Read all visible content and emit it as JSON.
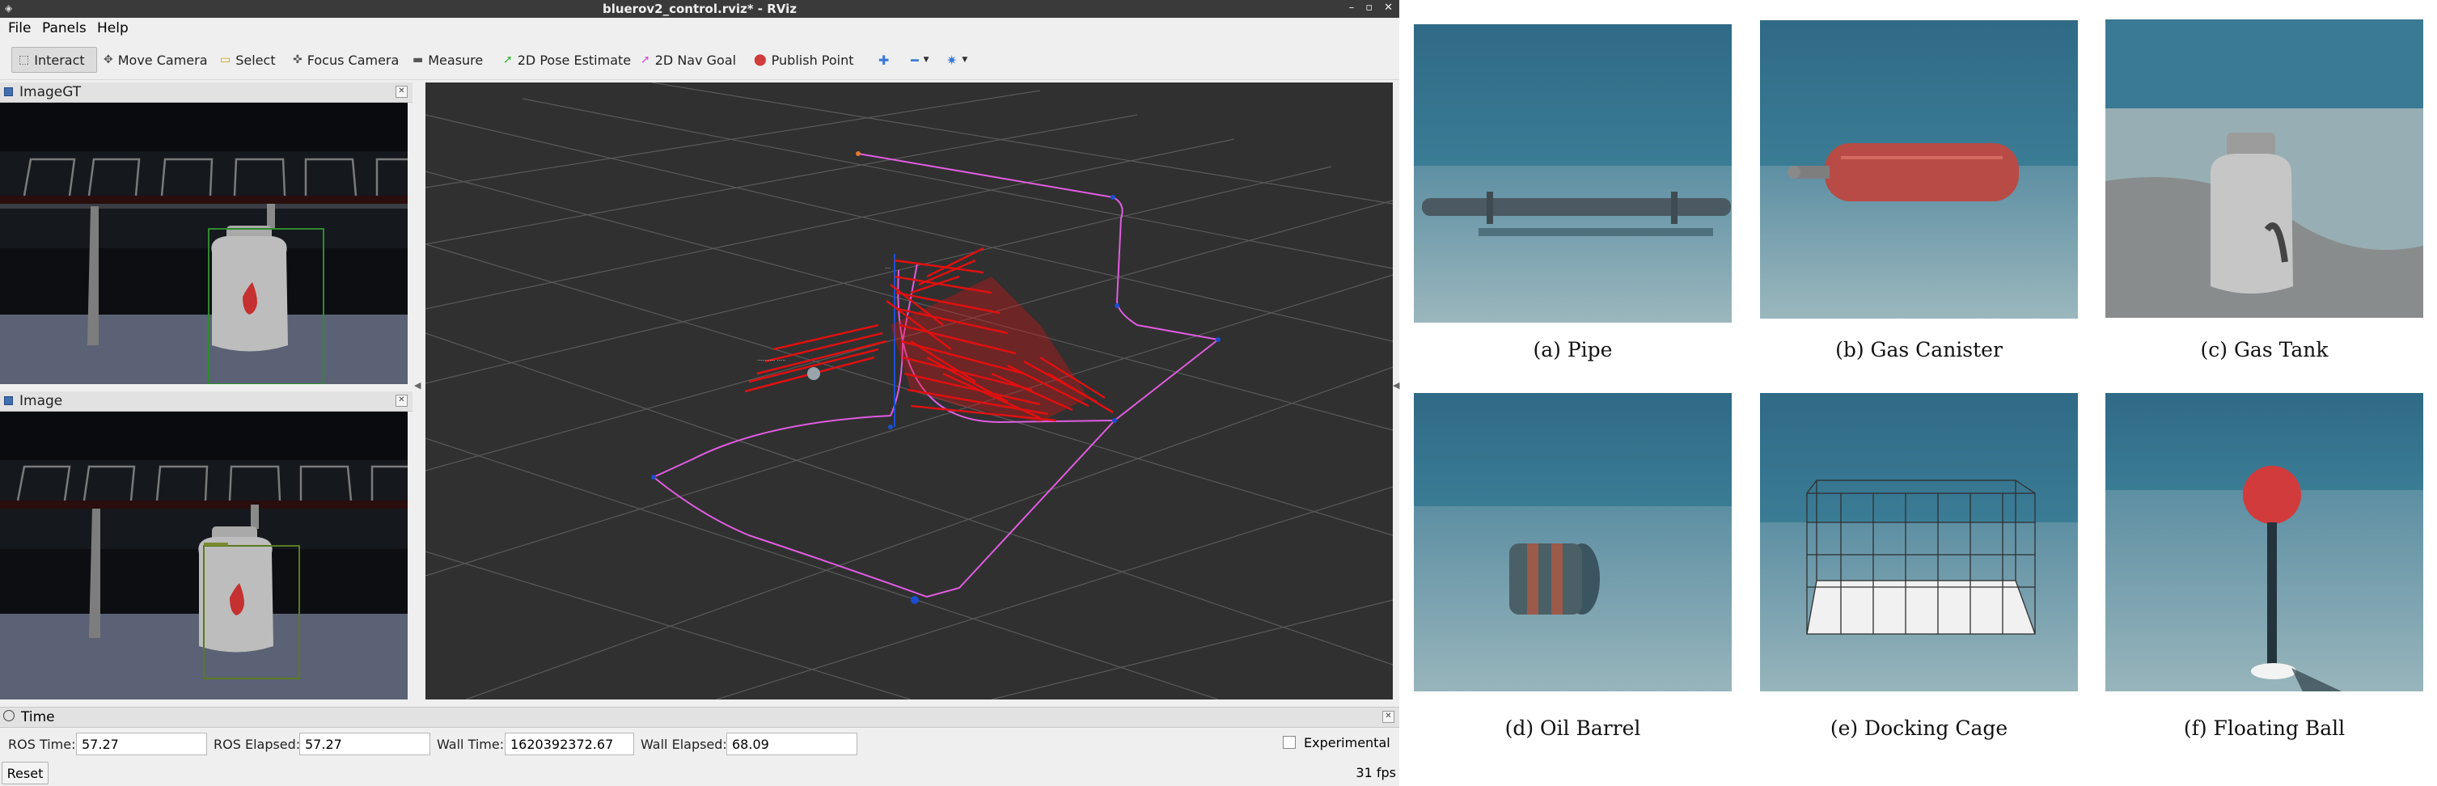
{
  "window": {
    "title": "bluerov2_control.rviz* - RViz",
    "controls": [
      "–",
      "▫",
      "✕"
    ]
  },
  "menu": [
    "File",
    "Panels",
    "Help"
  ],
  "toolbar": {
    "interact": "Interact",
    "move_camera": "Move Camera",
    "select": "Select",
    "focus_camera": "Focus Camera",
    "measure": "Measure",
    "pose_estimate": "2D Pose Estimate",
    "nav_goal": "2D Nav Goal",
    "publish_point": "Publish Point"
  },
  "panels": {
    "image_gt": {
      "title": "ImageGT"
    },
    "image": {
      "title": "Image"
    }
  },
  "time_panel": {
    "title": "Time",
    "ros_time_label": "ROS Time:",
    "ros_time": "57.27",
    "ros_elapsed_label": "ROS Elapsed:",
    "ros_elapsed": "57.27",
    "wall_time_label": "Wall Time:",
    "wall_time": "1620392372.67",
    "wall_elapsed_label": "Wall Elapsed:",
    "wall_elapsed": "68.09",
    "experimental_label": "Experimental",
    "experimental_checked": false,
    "reset_label": "Reset",
    "fps": "31 fps"
  },
  "figure": {
    "captions": [
      "(a) Pipe",
      "(b) Gas Canister",
      "(c) Gas Tank",
      "(d) Oil Barrel",
      "(e) Docking Cage",
      "(f) Floating Ball"
    ]
  },
  "colors": {
    "path": "#e05ce0",
    "arrows": "#e01010",
    "waypoint": "#1a4fd0",
    "grid": "#5a5a5a",
    "view_bg": "#303030",
    "water": "#2f6a86"
  }
}
